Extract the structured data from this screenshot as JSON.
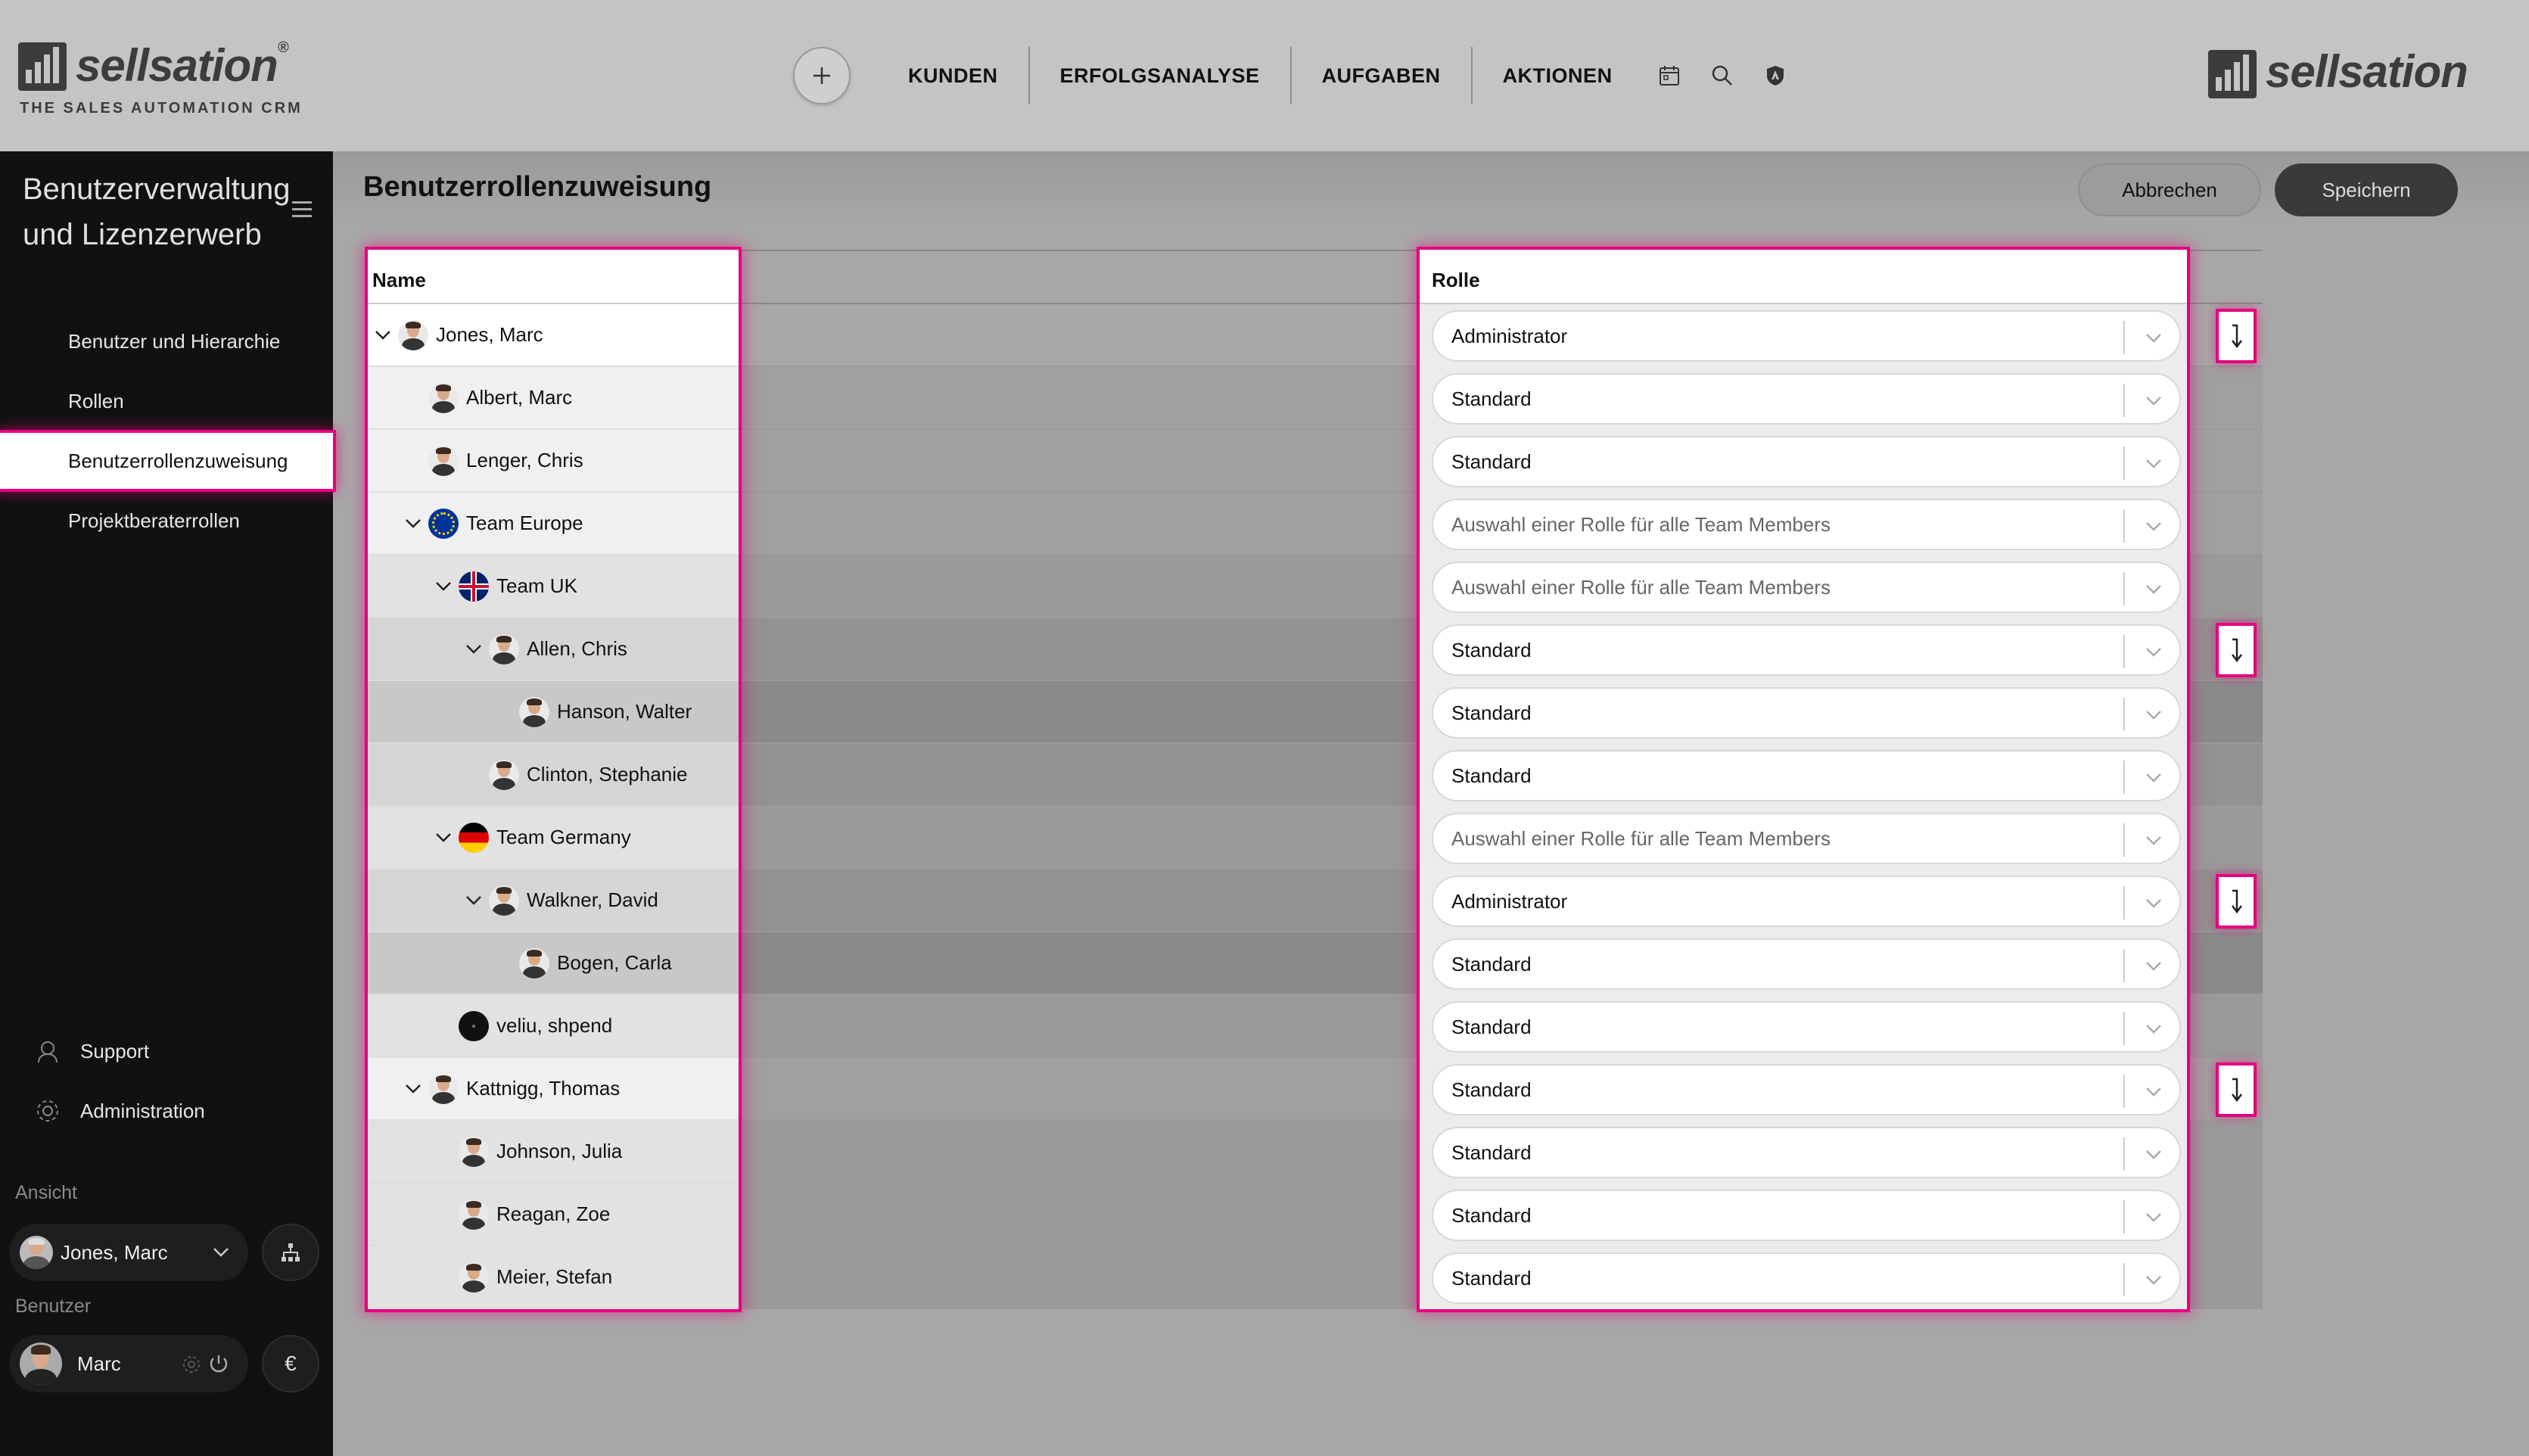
{
  "colors": {
    "accent": "#e6007e",
    "sidebar_bg": "#111111",
    "topbar_bg": "#c4c4c4"
  },
  "brand": {
    "name": "sellsation",
    "tagline": "THE SALES AUTOMATION CRM",
    "registered": "®"
  },
  "topnav": {
    "add_icon": "plus-icon",
    "items": [
      "KUNDEN",
      "ERFOLGSANALYSE",
      "AUFGABEN",
      "AKTIONEN"
    ],
    "icons": [
      "calendar-icon",
      "search-icon",
      "shield-icon"
    ]
  },
  "sidebar": {
    "title": "Benutzerverwaltung und Lizenzerwerb",
    "items": [
      {
        "label": "Benutzer und Hierarchie"
      },
      {
        "label": "Rollen"
      },
      {
        "label": "Benutzerrollenzuweisung"
      },
      {
        "label": "Projektberaterrollen"
      }
    ],
    "footer": [
      {
        "label": "Support",
        "icon": "headset-icon"
      },
      {
        "label": "Administration",
        "icon": "gear-icon"
      }
    ],
    "view_label": "Ansicht",
    "view_user": "Jones, Marc",
    "user_label": "Benutzer",
    "user_name": "Marc",
    "currency": "€"
  },
  "page": {
    "title": "Benutzerrollenzuweisung",
    "cancel_label": "Abbrechen",
    "save_label": "Speichern"
  },
  "table": {
    "col_name": "Name",
    "col_role": "Rolle",
    "placeholder": "Auswahl einer Rolle für alle Team Members",
    "rows": [
      {
        "name": "Jones, Marc",
        "level": 0,
        "expand": true,
        "kind": "person",
        "role": "Administrator",
        "action": true
      },
      {
        "name": "Albert, Marc",
        "level": 1,
        "expand": false,
        "kind": "person",
        "role": "Standard",
        "action": false
      },
      {
        "name": "Lenger, Chris",
        "level": 1,
        "expand": false,
        "kind": "person",
        "role": "Standard",
        "action": false
      },
      {
        "name": "Team Europe",
        "level": 1,
        "expand": true,
        "kind": "flag-eu",
        "role": "",
        "action": false
      },
      {
        "name": "Team UK",
        "level": 2,
        "expand": true,
        "kind": "flag-uk",
        "role": "",
        "action": false
      },
      {
        "name": "Allen, Chris",
        "level": 3,
        "expand": true,
        "kind": "person",
        "role": "Standard",
        "action": true
      },
      {
        "name": "Hanson, Walter",
        "level": 4,
        "expand": false,
        "kind": "person",
        "role": "Standard",
        "action": false
      },
      {
        "name": "Clinton, Stephanie",
        "level": 3,
        "expand": false,
        "kind": "person",
        "role": "Standard",
        "action": false
      },
      {
        "name": "Team Germany",
        "level": 2,
        "expand": true,
        "kind": "flag-de",
        "role": "",
        "action": false
      },
      {
        "name": "Walkner, David",
        "level": 3,
        "expand": true,
        "kind": "person",
        "role": "Administrator",
        "action": true
      },
      {
        "name": "Bogen, Carla",
        "level": 4,
        "expand": false,
        "kind": "person",
        "role": "Standard",
        "action": false
      },
      {
        "name": "veliu, shpend",
        "level": 2,
        "expand": false,
        "kind": "dark",
        "role": "Standard",
        "action": false
      },
      {
        "name": "Kattnigg, Thomas",
        "level": 1,
        "expand": true,
        "kind": "person",
        "role": "Standard",
        "action": true
      },
      {
        "name": "Johnson, Julia",
        "level": 2,
        "expand": false,
        "kind": "person",
        "role": "Standard",
        "action": false
      },
      {
        "name": "Reagan, Zoe",
        "level": 2,
        "expand": false,
        "kind": "person",
        "role": "Standard",
        "action": false
      },
      {
        "name": "Meier, Stefan",
        "level": 2,
        "expand": false,
        "kind": "person",
        "role": "Standard",
        "action": false
      }
    ],
    "action_icon": "arrow-down-icon"
  }
}
